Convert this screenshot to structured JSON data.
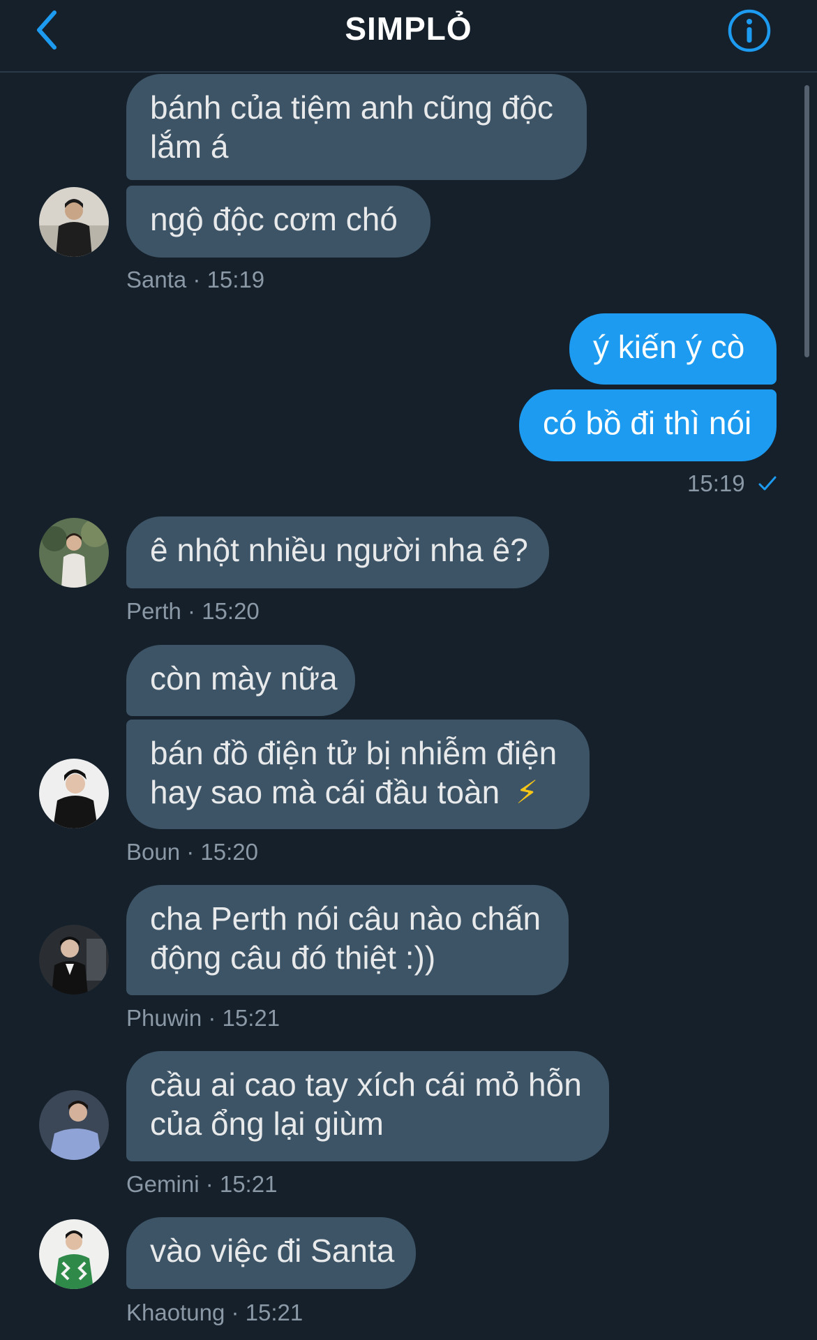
{
  "header": {
    "title": "SIMPLỎ"
  },
  "colors": {
    "background": "#15202b",
    "incoming_bubble": "#3d5466",
    "outgoing_bubble": "#1d9bf0",
    "accent": "#1d9bf0",
    "meta_text": "#8b98a5"
  },
  "icons": {
    "back": "chevron-left-icon",
    "info": "info-circle-icon",
    "read": "checkmark-icon"
  },
  "messages": {
    "santa_1_line1": "bánh của tiệm anh cũng độc",
    "santa_1_line2": "lắm á",
    "santa_2": "ngộ độc cơm chó",
    "santa_meta": "Santa · 15:19",
    "me_1": "ý kiến ý cò",
    "me_2": "có bồ đi thì nói",
    "me_meta": "15:19",
    "perth_1": "ê nhột nhiều người nha ê?",
    "perth_meta": "Perth · 15:20",
    "boun_1": "còn mày nữa",
    "boun_2_line1": "bán đồ điện tử bị nhiễm điện",
    "boun_2_line2": "hay sao mà cái đầu toàn",
    "boun_2_emoji": "⚡",
    "boun_meta": "Boun · 15:20",
    "phuwin_1_line1": "cha Perth nói câu nào chấn",
    "phuwin_1_line2": "động câu đó thiệt :))",
    "phuwin_meta": "Phuwin · 15:21",
    "gemini_1_line1": "cầu ai cao tay xích cái mỏ hỗn",
    "gemini_1_line2": "của ổng lại giùm",
    "gemini_meta": "Gemini · 15:21",
    "khaotung_1": "vào việc đi Santa",
    "khaotung_meta": "Khaotung · 15:21"
  }
}
